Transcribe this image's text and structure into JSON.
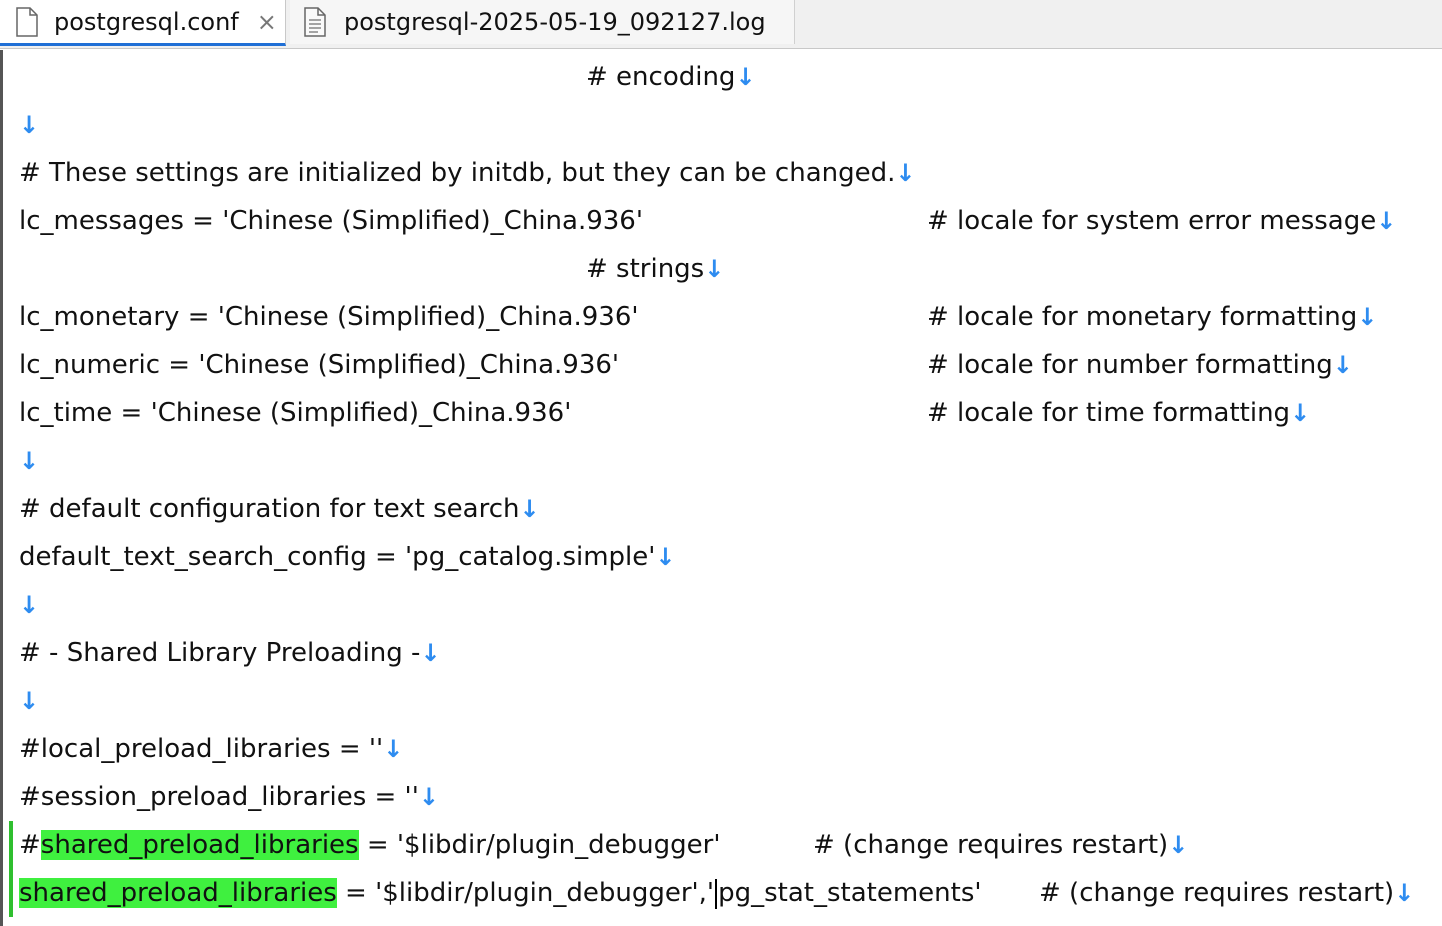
{
  "tabs": [
    {
      "label": "postgresql.conf",
      "close": "×"
    },
    {
      "label": "postgresql-2025-05-19_092127.log"
    }
  ],
  "editor": {
    "return_marker": "↓",
    "lines": {
      "l1": {
        "text": "# encoding"
      },
      "l3": {
        "text": "# These settings are initialized by initdb, but they can be changed."
      },
      "l4": {
        "text": "lc_messages = 'Chinese (Simplified)_China.936'",
        "comment": "# locale for system error message"
      },
      "l5": {
        "text": "# strings"
      },
      "l6": {
        "text": "lc_monetary = 'Chinese (Simplified)_China.936'",
        "comment": "# locale for monetary formatting"
      },
      "l7": {
        "text": "lc_numeric = 'Chinese (Simplified)_China.936'",
        "comment": "# locale for number formatting"
      },
      "l8": {
        "text": "lc_time = 'Chinese (Simplified)_China.936'",
        "comment": "# locale for time formatting"
      },
      "l10": {
        "text": "# default configuration for text search"
      },
      "l11": {
        "text": "default_text_search_config = 'pg_catalog.simple'"
      },
      "l13": {
        "text": "# - Shared Library Preloading -"
      },
      "l15": {
        "text": "#local_preload_libraries = ''"
      },
      "l16": {
        "text": "#session_preload_libraries = ''"
      },
      "l17": {
        "prefix": "#",
        "highlight": "shared_preload_libraries",
        "rest": " = '$libdir/plugin_debugger'",
        "comment": "# (change requires restart)"
      },
      "l18": {
        "highlight": "shared_preload_libraries",
        "rest_before_caret": " = '$libdir/plugin_debugger','",
        "rest_after_caret": "pg_stat_statements'",
        "comment": "# (change requires restart)"
      }
    }
  }
}
